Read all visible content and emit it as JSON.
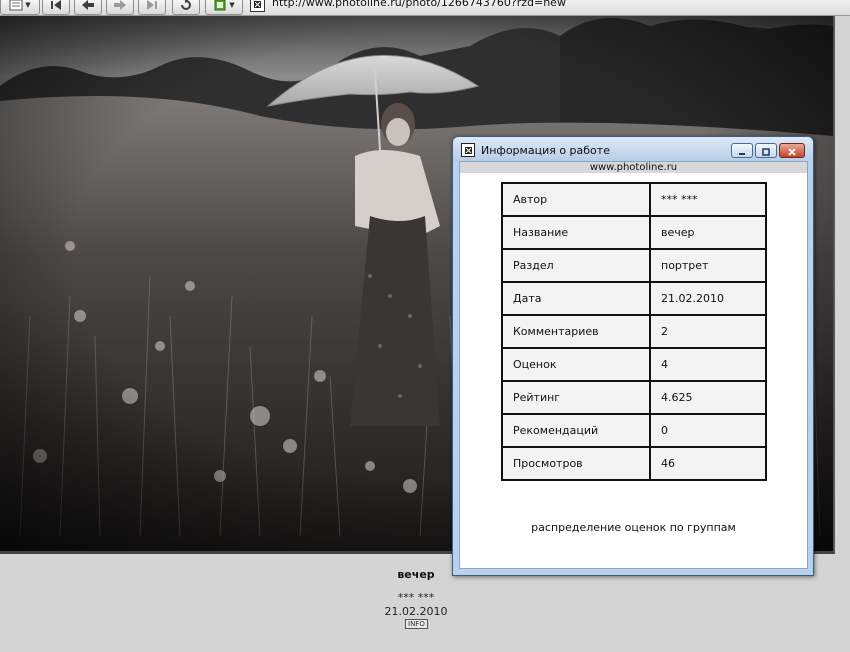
{
  "browser": {
    "url": "http://www.photoline.ru/photo/1266743760?rzd=new",
    "icons": [
      "page-menu-icon",
      "first-icon",
      "back-icon",
      "forward-icon",
      "last-icon",
      "reload-icon",
      "bookmark-icon"
    ]
  },
  "photo": {
    "description_alt": "",
    "caption_title": "вечер",
    "caption_author": "*** ***",
    "caption_date": "21.02.2010",
    "info_button": "INFO"
  },
  "popup": {
    "title": "Информация о работе",
    "site": "www.photoline.ru",
    "rows": [
      {
        "label": "Автор",
        "value": "*** ***"
      },
      {
        "label": "Название",
        "value": "вечер"
      },
      {
        "label": "Раздел",
        "value": "портрет"
      },
      {
        "label": "Дата",
        "value": "21.02.2010"
      },
      {
        "label": "Комментариев",
        "value": "2"
      },
      {
        "label": "Оценок",
        "value": "4"
      },
      {
        "label": "Рейтинг",
        "value": "4.625"
      },
      {
        "label": "Рекомендаций",
        "value": "0"
      },
      {
        "label": "Просмотров",
        "value": "46"
      }
    ],
    "distribution_link": "распределение оценок по группам"
  },
  "colors": {
    "page_bg": "#d4d4d4",
    "popup_frame": "#b9d1ea",
    "close_button": "#c5432a"
  }
}
